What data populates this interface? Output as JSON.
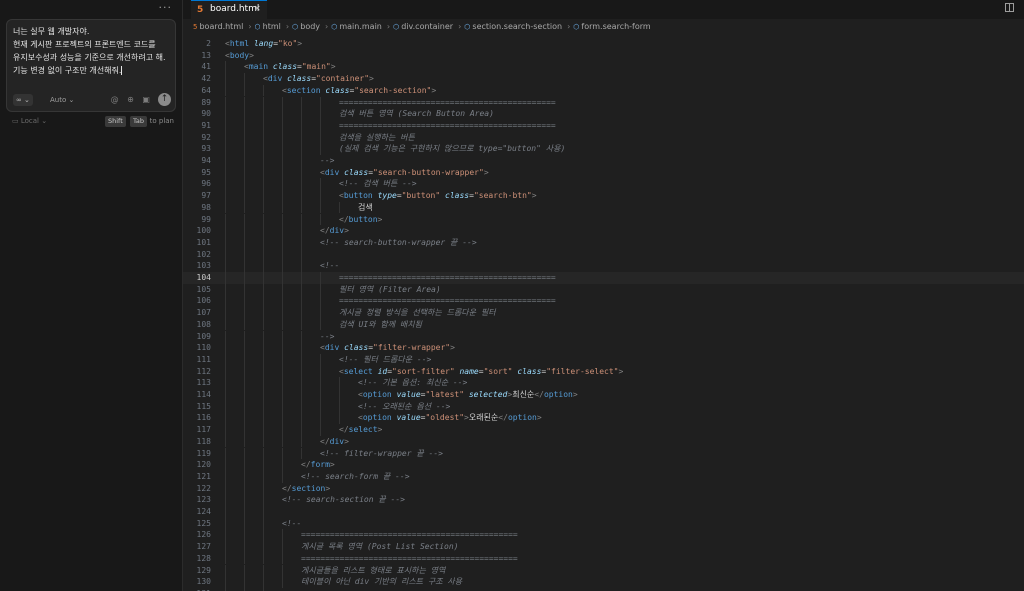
{
  "chat": {
    "menu_glyph": "···",
    "message_lines": [
      "너는 실무 웹 개발자야.",
      "현재 게시판 프로젝트의 프론트엔드 코드를",
      "유지보수성과 성능을 기준으로 개선하려고 해.",
      "기능 변경 없이 구조만 개선해줘."
    ],
    "mode_label": "∞ ⌄",
    "model_label": "Auto ⌄",
    "icons": [
      "at-icon",
      "globe-icon",
      "image-icon"
    ],
    "icon_glyphs": "@ ⊕ ▣",
    "send_glyph": "↑",
    "local_label": "▭ Local ⌄",
    "shift_key": "Shift",
    "tab_key": "Tab",
    "plan_hint": "to plan"
  },
  "editor": {
    "tab_name": "board.html",
    "tab_icon": "5",
    "close_glyph": "✕",
    "breadcrumb": [
      "board.html",
      "html",
      "body",
      "main.main",
      "div.container",
      "section.search-section",
      "form.search-form"
    ],
    "current_line": "104",
    "lines": [
      {
        "n": "2",
        "html": "<span class='t'>&lt;</span><span class='tag'>html</span> <span class='attr'>lang</span><span class='plain'>=</span><span class='str'>\"ko\"</span><span class='t'>&gt;</span>",
        "indent": 0
      },
      {
        "n": "13",
        "html": "<span class='t'>&lt;</span><span class='tag'>body</span><span class='t'>&gt;</span>",
        "indent": 0
      },
      {
        "n": "41",
        "html": "<span class='t'>&lt;</span><span class='tag'>main</span> <span class='attr'>class</span><span class='plain'>=</span><span class='str'>\"main\"</span><span class='t'>&gt;</span>",
        "indent": 1
      },
      {
        "n": "42",
        "html": "<span class='t'>&lt;</span><span class='tag'>div</span> <span class='attr'>class</span><span class='plain'>=</span><span class='str'>\"container\"</span><span class='t'>&gt;</span>",
        "indent": 2
      },
      {
        "n": "64",
        "html": "<span class='t'>&lt;</span><span class='tag'>section</span> <span class='attr'>class</span><span class='plain'>=</span><span class='str'>\"search-section\"</span><span class='t'>&gt;</span>",
        "indent": 3
      },
      {
        "n": "89",
        "html": "<span class='cm'>=============================================</span>",
        "indent": 6
      },
      {
        "n": "90",
        "html": "<span class='cm'>검색 버튼 영역 (Search Button Area)</span>",
        "indent": 6
      },
      {
        "n": "91",
        "html": "<span class='cm'>=============================================</span>",
        "indent": 6
      },
      {
        "n": "92",
        "html": "<span class='cm'>검색을 실행하는 버튼</span>",
        "indent": 6
      },
      {
        "n": "93",
        "html": "<span class='cm'>(실제 검색 기능은 구현하지 않으므로 type=\"button\" 사용)</span>",
        "indent": 6
      },
      {
        "n": "94",
        "html": "<span class='cm'>--&gt;</span>",
        "indent": 5
      },
      {
        "n": "95",
        "html": "<span class='t'>&lt;</span><span class='tag'>div</span> <span class='attr'>class</span><span class='plain'>=</span><span class='str'>\"search-button-wrapper\"</span><span class='t'>&gt;</span>",
        "indent": 5
      },
      {
        "n": "96",
        "html": "<span class='cm'>&lt;!-- 검색 버튼 --&gt;</span>",
        "indent": 6
      },
      {
        "n": "97",
        "html": "<span class='t'>&lt;</span><span class='tag'>button</span> <span class='attr'>type</span><span class='plain'>=</span><span class='str'>\"button\"</span> <span class='attr'>class</span><span class='plain'>=</span><span class='str'>\"search-btn\"</span><span class='t'>&gt;</span>",
        "indent": 6
      },
      {
        "n": "98",
        "html": "<span class='plain'>검색</span>",
        "indent": 7
      },
      {
        "n": "99",
        "html": "<span class='t'>&lt;/</span><span class='tag'>button</span><span class='t'>&gt;</span>",
        "indent": 6
      },
      {
        "n": "100",
        "html": "<span class='t'>&lt;/</span><span class='tag'>div</span><span class='t'>&gt;</span>",
        "indent": 5
      },
      {
        "n": "101",
        "html": "<span class='cm'>&lt;!-- search-button-wrapper 끝 --&gt;</span>",
        "indent": 5
      },
      {
        "n": "102",
        "html": "",
        "indent": 5
      },
      {
        "n": "103",
        "html": "<span class='cm'>&lt;!--</span>",
        "indent": 5
      },
      {
        "n": "104",
        "html": "<span class='cm'>=============================================</span>",
        "indent": 6
      },
      {
        "n": "105",
        "html": "<span class='cm'>필터 영역 (Filter Area)</span>",
        "indent": 6
      },
      {
        "n": "106",
        "html": "<span class='cm'>=============================================</span>",
        "indent": 6
      },
      {
        "n": "107",
        "html": "<span class='cm'>게시글 정렬 방식을 선택하는 드롭다운 필터</span>",
        "indent": 6
      },
      {
        "n": "108",
        "html": "<span class='cm'>검색 UI와 함께 배치됨</span>",
        "indent": 6
      },
      {
        "n": "109",
        "html": "<span class='cm'>--&gt;</span>",
        "indent": 5
      },
      {
        "n": "110",
        "html": "<span class='t'>&lt;</span><span class='tag'>div</span> <span class='attr'>class</span><span class='plain'>=</span><span class='str'>\"filter-wrapper\"</span><span class='t'>&gt;</span>",
        "indent": 5
      },
      {
        "n": "111",
        "html": "<span class='cm'>&lt;!-- 필터 드롭다운 --&gt;</span>",
        "indent": 6
      },
      {
        "n": "112",
        "html": "<span class='t'>&lt;</span><span class='tag'>select</span> <span class='attr'>id</span><span class='plain'>=</span><span class='str'>\"sort-filter\"</span> <span class='attr'>name</span><span class='plain'>=</span><span class='str'>\"sort\"</span> <span class='attr'>class</span><span class='plain'>=</span><span class='str'>\"filter-select\"</span><span class='t'>&gt;</span>",
        "indent": 6
      },
      {
        "n": "113",
        "html": "<span class='cm'>&lt;!-- 기본 옵션: 최신순 --&gt;</span>",
        "indent": 7
      },
      {
        "n": "114",
        "html": "<span class='t'>&lt;</span><span class='tag'>option</span> <span class='attr'>value</span><span class='plain'>=</span><span class='str'>\"latest\"</span> <span class='attr'>selected</span><span class='t'>&gt;</span><span class='plain'>최신순</span><span class='t'>&lt;/</span><span class='tag'>option</span><span class='t'>&gt;</span>",
        "indent": 7
      },
      {
        "n": "115",
        "html": "<span class='cm'>&lt;!-- 오래된순 옵션 --&gt;</span>",
        "indent": 7
      },
      {
        "n": "116",
        "html": "<span class='t'>&lt;</span><span class='tag'>option</span> <span class='attr'>value</span><span class='plain'>=</span><span class='str'>\"oldest\"</span><span class='t'>&gt;</span><span class='plain'>오래된순</span><span class='t'>&lt;/</span><span class='tag'>option</span><span class='t'>&gt;</span>",
        "indent": 7
      },
      {
        "n": "117",
        "html": "<span class='t'>&lt;/</span><span class='tag'>select</span><span class='t'>&gt;</span>",
        "indent": 6
      },
      {
        "n": "118",
        "html": "<span class='t'>&lt;/</span><span class='tag'>div</span><span class='t'>&gt;</span>",
        "indent": 5
      },
      {
        "n": "119",
        "html": "<span class='cm'>&lt;!-- filter-wrapper 끝 --&gt;</span>",
        "indent": 5
      },
      {
        "n": "120",
        "html": "<span class='t'>&lt;/</span><span class='tag'>form</span><span class='t'>&gt;</span>",
        "indent": 4
      },
      {
        "n": "121",
        "html": "<span class='cm'>&lt;!-- search-form 끝 --&gt;</span>",
        "indent": 4
      },
      {
        "n": "122",
        "html": "<span class='t'>&lt;/</span><span class='tag'>section</span><span class='t'>&gt;</span>",
        "indent": 3
      },
      {
        "n": "123",
        "html": "<span class='cm'>&lt;!-- search-section 끝 --&gt;</span>",
        "indent": 3
      },
      {
        "n": "124",
        "html": "",
        "indent": 3
      },
      {
        "n": "125",
        "html": "<span class='cm'>&lt;!--</span>",
        "indent": 3
      },
      {
        "n": "126",
        "html": "<span class='cm'>=============================================</span>",
        "indent": 4
      },
      {
        "n": "127",
        "html": "<span class='cm'>게시글 목록 영역 (Post List Section)</span>",
        "indent": 4
      },
      {
        "n": "128",
        "html": "<span class='cm'>=============================================</span>",
        "indent": 4
      },
      {
        "n": "129",
        "html": "<span class='cm'>게시글들을 리스트 형태로 표시하는 영역</span>",
        "indent": 4
      },
      {
        "n": "130",
        "html": "<span class='cm'>테이블이 아닌 div 기반의 리스트 구조 사용</span>",
        "indent": 4
      },
      {
        "n": "131",
        "html": "<span class='cm'>--&gt;</span>",
        "indent": 3
      }
    ]
  }
}
